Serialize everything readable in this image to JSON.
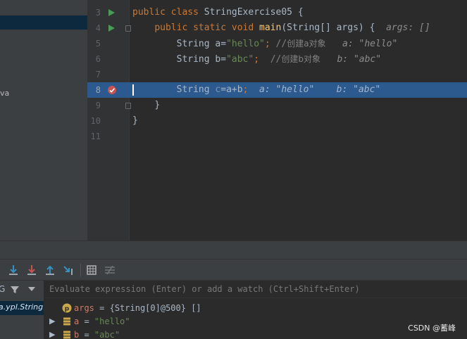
{
  "project": {
    "fragment": "va"
  },
  "lines": [
    {
      "num": "3",
      "indent": "",
      "tokens": [
        [
          "kw",
          "public "
        ],
        [
          "kw",
          "class "
        ],
        [
          "plain",
          "StringExercise05 {"
        ]
      ]
    },
    {
      "num": "4",
      "indent": "    ",
      "tokens": [
        [
          "kw",
          "public static void "
        ],
        [
          "fn",
          "main"
        ],
        [
          "plain",
          "(String[] args) {  "
        ],
        [
          "hint",
          "args: []"
        ]
      ]
    },
    {
      "num": "5",
      "indent": "        ",
      "tokens": [
        [
          "plain",
          "String a="
        ],
        [
          "str",
          "\"hello\""
        ],
        [
          "kw",
          "; "
        ],
        [
          "cm",
          "//"
        ],
        [
          "cmcn",
          "创建a对象"
        ],
        [
          "plain",
          "   "
        ],
        [
          "hint",
          "a: \"hello\""
        ]
      ]
    },
    {
      "num": "6",
      "indent": "        ",
      "tokens": [
        [
          "plain",
          "String b="
        ],
        [
          "str",
          "\"abc\""
        ],
        [
          "kw",
          ";  "
        ],
        [
          "cm",
          "//"
        ],
        [
          "cmcn",
          "创建b对象"
        ],
        [
          "plain",
          "   "
        ],
        [
          "hint",
          "b: \"abc\""
        ]
      ]
    },
    {
      "num": "7",
      "indent": "",
      "tokens": []
    },
    {
      "num": "8",
      "indent": "        ",
      "tokens": [
        [
          "plain",
          "String "
        ],
        [
          "unused",
          "c"
        ],
        [
          "plain",
          "=a+b"
        ],
        [
          "kw",
          ";  "
        ],
        [
          "hinthl",
          "a: \"hello\"    b: \"abc\""
        ]
      ]
    },
    {
      "num": "9",
      "indent": "    ",
      "tokens": [
        [
          "plain",
          "}"
        ]
      ]
    },
    {
      "num": "10",
      "indent": "",
      "tokens": [
        [
          "plain",
          "}"
        ]
      ]
    },
    {
      "num": "11",
      "indent": "",
      "tokens": []
    }
  ],
  "debug": {
    "frames_header": "G",
    "frame_selected": "a.ypl.String.",
    "evaluate_placeholder": "Evaluate expression (Enter) or add a watch (Ctrl+Shift+Enter)",
    "variables": [
      {
        "name": "args",
        "eq": " = ",
        "value": "{String[0]@500} []",
        "icon": "param-icon",
        "expandable": false
      },
      {
        "name": "a",
        "eq": " = ",
        "value": "\"hello\"",
        "icon": "field-icon",
        "expandable": true
      },
      {
        "name": "b",
        "eq": " = ",
        "value": "\"abc\"",
        "icon": "field-icon",
        "expandable": true
      }
    ]
  },
  "watermark": "CSDN @蓄峰",
  "colors": {
    "accent": "#2d5a8e",
    "keyword": "#cc7832",
    "string": "#6a8759",
    "breakpoint": "#c75450",
    "run": "#499c54"
  }
}
